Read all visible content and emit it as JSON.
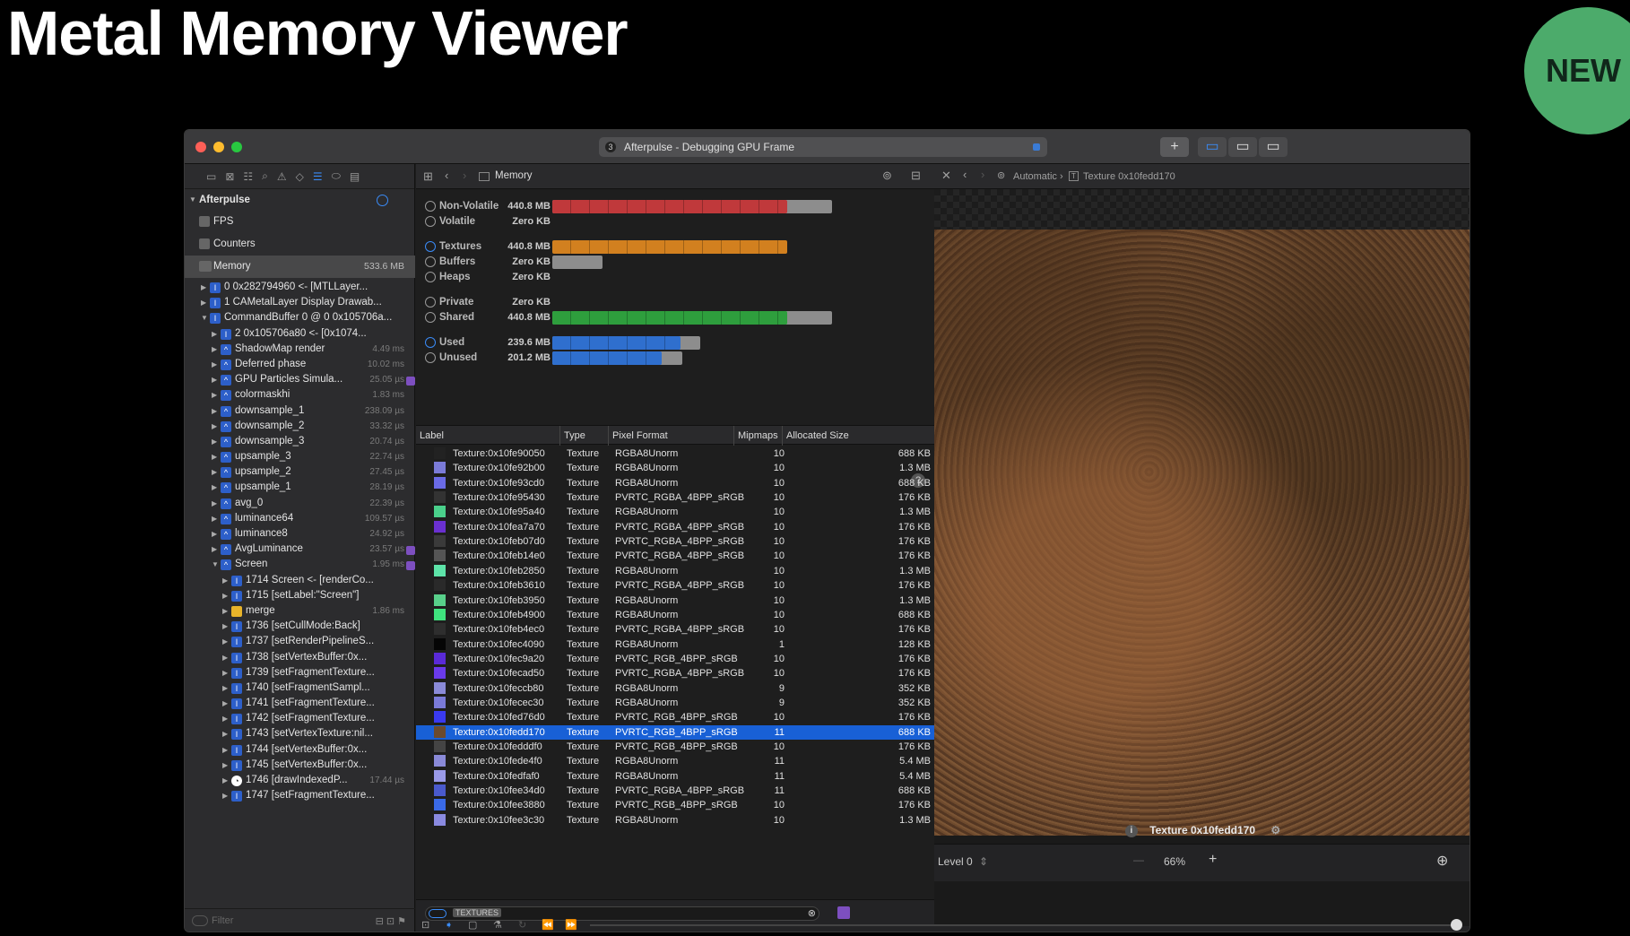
{
  "slide": {
    "title": "Metal Memory Viewer",
    "badge": "NEW"
  },
  "window": {
    "title": "Afterpulse - Debugging GPU Frame",
    "tab_number": "3"
  },
  "navigator": {
    "root": "Afterpulse",
    "items": [
      {
        "label": "FPS"
      },
      {
        "label": "Counters"
      },
      {
        "label": "Memory",
        "value": "533.6 MB"
      }
    ],
    "tree": [
      {
        "label": "0 0x282794960 <- [MTLLayer...",
        "time": ""
      },
      {
        "label": "1 CAMetalLayer Display Drawab...",
        "time": ""
      },
      {
        "label": "CommandBuffer 0 @ 0 0x105706a...",
        "time": ""
      },
      {
        "label": "2 0x105706a80 <- [0x1074...",
        "time": ""
      },
      {
        "label": "ShadowMap render",
        "time": "4.49 ms"
      },
      {
        "label": "Deferred phase",
        "time": "10.02 ms"
      },
      {
        "label": "GPU Particles Simula...",
        "time": "25.05 µs"
      },
      {
        "label": "colormaskhi",
        "time": "1.83 ms"
      },
      {
        "label": "downsample_1",
        "time": "238.09 µs"
      },
      {
        "label": "downsample_2",
        "time": "33.32 µs"
      },
      {
        "label": "downsample_3",
        "time": "20.74 µs"
      },
      {
        "label": "upsample_3",
        "time": "22.74 µs"
      },
      {
        "label": "upsample_2",
        "time": "27.45 µs"
      },
      {
        "label": "upsample_1",
        "time": "28.19 µs"
      },
      {
        "label": "avg_0",
        "time": "22.39 µs"
      },
      {
        "label": "luminance64",
        "time": "109.57 µs"
      },
      {
        "label": "luminance8",
        "time": "24.92 µs"
      },
      {
        "label": "AvgLuminance",
        "time": "23.57 µs"
      },
      {
        "label": "Screen",
        "time": "1.95 ms"
      },
      {
        "label": "1714 Screen <- [renderCo...",
        "time": ""
      },
      {
        "label": "1715 [setLabel:\"Screen\"]",
        "time": ""
      },
      {
        "label": "merge",
        "time": "1.86 ms"
      },
      {
        "label": "1736 [setCullMode:Back]",
        "time": ""
      },
      {
        "label": "1737 [setRenderPipelineS...",
        "time": ""
      },
      {
        "label": "1738 [setVertexBuffer:0x...",
        "time": ""
      },
      {
        "label": "1739 [setFragmentTexture...",
        "time": ""
      },
      {
        "label": "1740 [setFragmentSampl...",
        "time": ""
      },
      {
        "label": "1741 [setFragmentTexture...",
        "time": ""
      },
      {
        "label": "1742 [setFragmentTexture...",
        "time": ""
      },
      {
        "label": "1743 [setVertexTexture:nil...",
        "time": ""
      },
      {
        "label": "1744 [setVertexBuffer:0x...",
        "time": ""
      },
      {
        "label": "1745 [setVertexBuffer:0x...",
        "time": ""
      },
      {
        "label": "1746 [drawIndexedP...",
        "time": "17.44 µs"
      },
      {
        "label": "1747 [setFragmentTexture...",
        "time": ""
      }
    ],
    "filter_placeholder": "Filter"
  },
  "memory": {
    "breadcrumb": "Memory",
    "summary": [
      {
        "label": "Non-Volatile",
        "value": "440.8 MB",
        "color": "#c0393b"
      },
      {
        "label": "Volatile",
        "value": "Zero KB",
        "color": ""
      },
      {
        "label": "Textures",
        "value": "440.8 MB",
        "color": "#d2801f"
      },
      {
        "label": "Buffers",
        "value": "Zero KB",
        "color": ""
      },
      {
        "label": "Heaps",
        "value": "Zero KB",
        "color": ""
      },
      {
        "label": "Private",
        "value": "Zero KB",
        "color": ""
      },
      {
        "label": "Shared",
        "value": "440.8 MB",
        "color": "#2e9e3d"
      },
      {
        "label": "Used",
        "value": "239.6 MB",
        "color": "#2f6fce"
      },
      {
        "label": "Unused",
        "value": "201.2 MB",
        "color": "#2f6fce"
      }
    ],
    "columns": [
      "Label",
      "Type",
      "Pixel Format",
      "Mipmaps",
      "Allocated Size"
    ],
    "rows": [
      [
        "Texture:0x10fe90050",
        "Texture",
        "RGBA8Unorm",
        "10",
        "688 KB"
      ],
      [
        "Texture:0x10fe92b00",
        "Texture",
        "RGBA8Unorm",
        "10",
        "1.3 MB"
      ],
      [
        "Texture:0x10fe93cd0",
        "Texture",
        "RGBA8Unorm",
        "10",
        "688 KB"
      ],
      [
        "Texture:0x10fe95430",
        "Texture",
        "PVRTC_RGBA_4BPP_sRGB",
        "10",
        "176 KB"
      ],
      [
        "Texture:0x10fe95a40",
        "Texture",
        "RGBA8Unorm",
        "10",
        "1.3 MB"
      ],
      [
        "Texture:0x10fea7a70",
        "Texture",
        "PVRTC_RGBA_4BPP_sRGB",
        "10",
        "176 KB"
      ],
      [
        "Texture:0x10feb07d0",
        "Texture",
        "PVRTC_RGBA_4BPP_sRGB",
        "10",
        "176 KB"
      ],
      [
        "Texture:0x10feb14e0",
        "Texture",
        "PVRTC_RGBA_4BPP_sRGB",
        "10",
        "176 KB"
      ],
      [
        "Texture:0x10feb2850",
        "Texture",
        "RGBA8Unorm",
        "10",
        "1.3 MB"
      ],
      [
        "Texture:0x10feb3610",
        "Texture",
        "PVRTC_RGBA_4BPP_sRGB",
        "10",
        "176 KB"
      ],
      [
        "Texture:0x10feb3950",
        "Texture",
        "RGBA8Unorm",
        "10",
        "1.3 MB"
      ],
      [
        "Texture:0x10feb4900",
        "Texture",
        "RGBA8Unorm",
        "10",
        "688 KB"
      ],
      [
        "Texture:0x10feb4ec0",
        "Texture",
        "PVRTC_RGBA_4BPP_sRGB",
        "10",
        "176 KB"
      ],
      [
        "Texture:0x10fec4090",
        "Texture",
        "RGBA8Unorm",
        "1",
        "128 KB"
      ],
      [
        "Texture:0x10fec9a20",
        "Texture",
        "PVRTC_RGB_4BPP_sRGB",
        "10",
        "176 KB"
      ],
      [
        "Texture:0x10fecad50",
        "Texture",
        "PVRTC_RGBA_4BPP_sRGB",
        "10",
        "176 KB"
      ],
      [
        "Texture:0x10feccb80",
        "Texture",
        "RGBA8Unorm",
        "9",
        "352 KB"
      ],
      [
        "Texture:0x10fecec30",
        "Texture",
        "RGBA8Unorm",
        "9",
        "352 KB"
      ],
      [
        "Texture:0x10fed76d0",
        "Texture",
        "PVRTC_RGB_4BPP_sRGB",
        "10",
        "176 KB"
      ],
      [
        "Texture:0x10fedd170",
        "Texture",
        "PVRTC_RGB_4BPP_sRGB",
        "11",
        "688 KB"
      ],
      [
        "Texture:0x10fedddf0",
        "Texture",
        "PVRTC_RGB_4BPP_sRGB",
        "10",
        "176 KB"
      ],
      [
        "Texture:0x10fede4f0",
        "Texture",
        "RGBA8Unorm",
        "11",
        "5.4 MB"
      ],
      [
        "Texture:0x10fedfaf0",
        "Texture",
        "RGBA8Unorm",
        "11",
        "5.4 MB"
      ],
      [
        "Texture:0x10fee34d0",
        "Texture",
        "PVRTC_RGBA_4BPP_sRGB",
        "11",
        "688 KB"
      ],
      [
        "Texture:0x10fee3880",
        "Texture",
        "PVRTC_RGB_4BPP_sRGB",
        "10",
        "176 KB"
      ],
      [
        "Texture:0x10fee3c30",
        "Texture",
        "RGBA8Unorm",
        "10",
        "1.3 MB"
      ]
    ],
    "swatch_colors": [
      "#222",
      "#7b7bd8",
      "#6b6be6",
      "#333",
      "#4ad08b",
      "#6a30d0",
      "#3a3a3a",
      "#555",
      "#5de3a8",
      "#2a2a2a",
      "#58d08a",
      "#3fe37e",
      "#2e2e2e",
      "#050505",
      "#5a2ad8",
      "#6a3aea",
      "#8a8ad8",
      "#7a7ad8",
      "#3a3af0",
      "#6b4a2d",
      "#444",
      "#8a8ad8",
      "#9a9ae8",
      "#4a5acd",
      "#3a6ae8",
      "#8a8ae0"
    ],
    "selected_index": 19,
    "filter_tag": "TEXTURES"
  },
  "viewer": {
    "breadcrumb_auto": "Automatic",
    "breadcrumb_texture": "Texture 0x10fedd170",
    "caption": "Texture 0x10fedd170",
    "level": "Level 0",
    "zoom": "66%"
  }
}
